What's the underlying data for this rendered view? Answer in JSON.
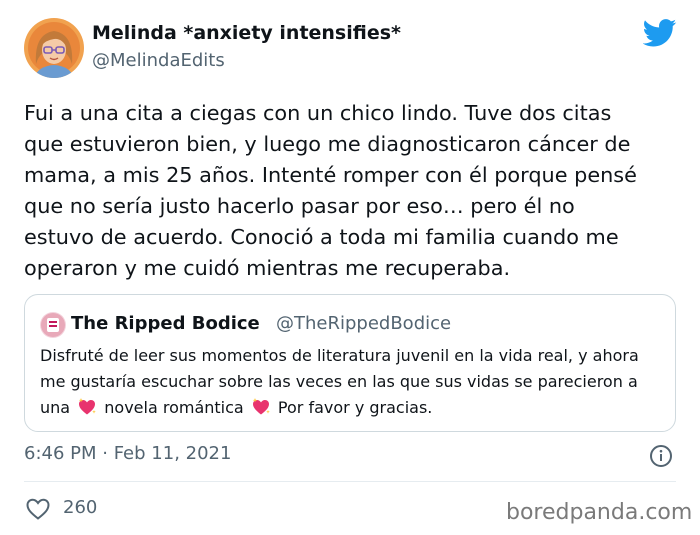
{
  "author": {
    "display_name": "Melinda *anxiety intensifies*",
    "handle": "@MelindaEdits"
  },
  "tweet": {
    "lines": [
      "Fui a una cita a ciegas con un chico lindo. Tuve dos citas",
      "que estuvieron bien, y luego me diagnosticaron cáncer de",
      "mama, a mis 25 años. Intenté romper con él porque pensé",
      "que no sería justo hacerlo pasar por eso… pero él no",
      "estuvo de acuerdo. Conoció a toda mi familia cuando me",
      "operaron y me cuidó mientras me recuperaba."
    ]
  },
  "quoted": {
    "display_name": "The Ripped Bodice",
    "handle": "@TheRippedBodice",
    "line1": "Disfruté de leer sus momentos de literatura juvenil en la vida real, y ahora",
    "line2": "me gustaría escuchar sobre las veces en las que sus vidas se parecieron a",
    "line3_a": "una",
    "line3_b": "novela romántica",
    "line3_c": "Por favor y gracias.",
    "emoji": "sparkling-heart-icon"
  },
  "meta": {
    "timestamp": "6:46 PM · Feb 11, 2021"
  },
  "actions": {
    "like_count": "260"
  },
  "watermark": "boredpanda.com",
  "colors": {
    "twitter_blue": "#1d9bf0",
    "text_primary": "#0f1419",
    "text_secondary": "#536471",
    "border": "#cfd9de"
  },
  "icons": {
    "brand": "twitter-bird-icon",
    "info": "info-icon",
    "like": "heart-outline-icon"
  }
}
